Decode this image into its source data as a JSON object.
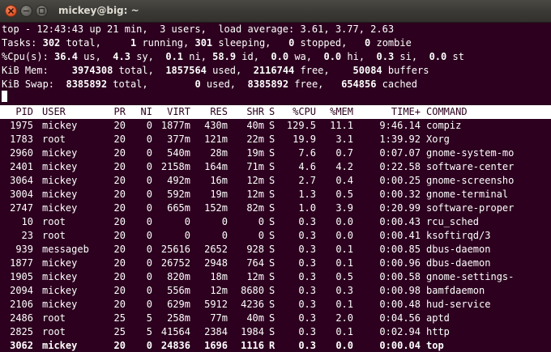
{
  "window": {
    "title": "mickey@big: ~",
    "controls": [
      "close",
      "minimize",
      "maximize"
    ]
  },
  "summary": {
    "uptime": {
      "label": "top - ",
      "time": "12:43:43",
      "text": " up 21 min,  3 users,  load average: 3.61, 3.77, 2.63"
    },
    "tasks": {
      "label": "Tasks:",
      "total": "302",
      "running": "1",
      "sleeping": "301",
      "stopped": "0",
      "zombie": "0"
    },
    "cpu": {
      "label": "%Cpu(s):",
      "us": "36.4",
      "sy": "4.3",
      "ni": "0.1",
      "id": "58.9",
      "wa": "0.0",
      "hi": "0.0",
      "si": "0.3",
      "st": "0.0"
    },
    "mem": {
      "label": "KiB Mem: ",
      "total": "3974308",
      "used": "1857564",
      "free": "2116744",
      "buffers": "50084"
    },
    "swap": {
      "label": "KiB Swap:",
      "total": "8385892",
      "used": "0",
      "free": "8385892",
      "cached": "654856"
    }
  },
  "table": {
    "columns": [
      "PID",
      "USER",
      "PR",
      "NI",
      "VIRT",
      "RES",
      "SHR",
      "S",
      "%CPU",
      "%MEM",
      "TIME+",
      "COMMAND"
    ],
    "rows": [
      [
        "1975",
        "mickey",
        "20",
        "0",
        "1877m",
        "430m",
        "40m",
        "S",
        "129.5",
        "11.1",
        "9:46.14",
        "compiz"
      ],
      [
        "1783",
        "root",
        "20",
        "0",
        "377m",
        "121m",
        "22m",
        "S",
        "19.9",
        "3.1",
        "1:39.92",
        "Xorg"
      ],
      [
        "2960",
        "mickey",
        "20",
        "0",
        "540m",
        "28m",
        "19m",
        "S",
        "7.6",
        "0.7",
        "0:07.07",
        "gnome-system-mo"
      ],
      [
        "2401",
        "mickey",
        "20",
        "0",
        "2158m",
        "164m",
        "71m",
        "S",
        "4.6",
        "4.2",
        "0:22.58",
        "software-center"
      ],
      [
        "3064",
        "mickey",
        "20",
        "0",
        "492m",
        "16m",
        "12m",
        "S",
        "2.7",
        "0.4",
        "0:00.25",
        "gnome-screensho"
      ],
      [
        "3004",
        "mickey",
        "20",
        "0",
        "592m",
        "19m",
        "12m",
        "S",
        "1.3",
        "0.5",
        "0:00.32",
        "gnome-terminal"
      ],
      [
        "2747",
        "mickey",
        "20",
        "0",
        "665m",
        "152m",
        "82m",
        "S",
        "1.0",
        "3.9",
        "0:20.99",
        "software-proper"
      ],
      [
        "10",
        "root",
        "20",
        "0",
        "0",
        "0",
        "0",
        "S",
        "0.3",
        "0.0",
        "0:00.43",
        "rcu_sched"
      ],
      [
        "23",
        "root",
        "20",
        "0",
        "0",
        "0",
        "0",
        "S",
        "0.3",
        "0.0",
        "0:00.41",
        "ksoftirqd/3"
      ],
      [
        "939",
        "messageb",
        "20",
        "0",
        "25616",
        "2652",
        "928",
        "S",
        "0.3",
        "0.1",
        "0:00.85",
        "dbus-daemon"
      ],
      [
        "1877",
        "mickey",
        "20",
        "0",
        "26752",
        "2948",
        "764",
        "S",
        "0.3",
        "0.1",
        "0:00.96",
        "dbus-daemon"
      ],
      [
        "1905",
        "mickey",
        "20",
        "0",
        "820m",
        "18m",
        "12m",
        "S",
        "0.3",
        "0.5",
        "0:00.58",
        "gnome-settings-"
      ],
      [
        "2094",
        "mickey",
        "20",
        "0",
        "556m",
        "12m",
        "8680",
        "S",
        "0.3",
        "0.3",
        "0:00.98",
        "bamfdaemon"
      ],
      [
        "2106",
        "mickey",
        "20",
        "0",
        "629m",
        "5912",
        "4236",
        "S",
        "0.3",
        "0.1",
        "0:00.48",
        "hud-service"
      ],
      [
        "2486",
        "root",
        "25",
        "5",
        "258m",
        "77m",
        "40m",
        "S",
        "0.3",
        "2.0",
        "0:04.56",
        "aptd"
      ],
      [
        "2825",
        "root",
        "25",
        "5",
        "41564",
        "2384",
        "1984",
        "S",
        "0.3",
        "0.1",
        "0:02.94",
        "http"
      ],
      [
        "3062",
        "mickey",
        "20",
        "0",
        "24836",
        "1696",
        "1116",
        "R",
        "0.3",
        "0.0",
        "0:00.04",
        "top"
      ]
    ],
    "bold_row_index": 16
  },
  "colors": {
    "terminal_bg": "#2c001e",
    "terminal_fg": "#ffffff",
    "titlebar_bg": "#3c3b37",
    "close_button": "#e2572a"
  }
}
